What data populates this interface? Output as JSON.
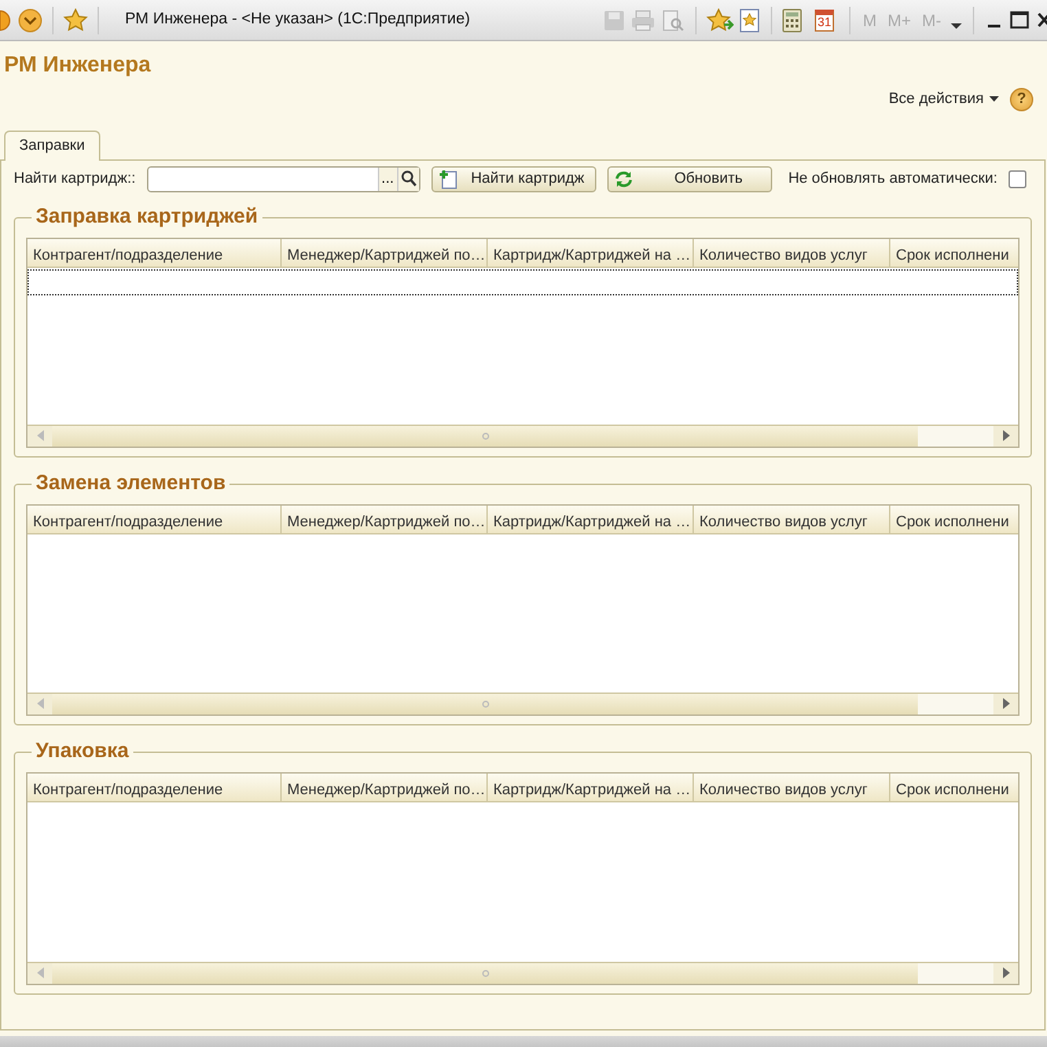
{
  "window": {
    "title": "РМ Инженера -  <Не указан>  (1С:Предприятие)",
    "memory_buttons": [
      "M",
      "M+",
      "M-"
    ],
    "calendar_day": "31"
  },
  "form": {
    "title": "РМ Инженера",
    "all_actions": "Все действия",
    "help": "?"
  },
  "tabs": [
    {
      "label": "Заправки",
      "selected": true
    }
  ],
  "toolbar": {
    "search_label": "Найти картридж::",
    "choose_button": "...",
    "find_button": "Найти картридж",
    "refresh_button": "Обновить",
    "no_refresh_label": "Не обновлять автоматически:",
    "no_refresh_checked": false
  },
  "groups": [
    {
      "title": "Заправка картриджей",
      "current_row": true,
      "columns": [
        "Контрагент/подразделение",
        "Менеджер/Картриджей по…",
        "Картридж/Картриджей на …",
        "Количество видов услуг",
        "Срок исполнени"
      ]
    },
    {
      "title": "Замена элементов",
      "current_row": false,
      "columns": [
        "Контрагент/подразделение",
        "Менеджер/Картриджей по…",
        "Картридж/Картриджей на …",
        "Количество видов услуг",
        "Срок исполнени"
      ]
    },
    {
      "title": "Упаковка",
      "current_row": false,
      "columns": [
        "Контрагент/подразделение",
        "Менеджер/Картриджей по…",
        "Картридж/Картриджей на …",
        "Количество видов услуг",
        "Срок исполнени"
      ]
    }
  ]
}
